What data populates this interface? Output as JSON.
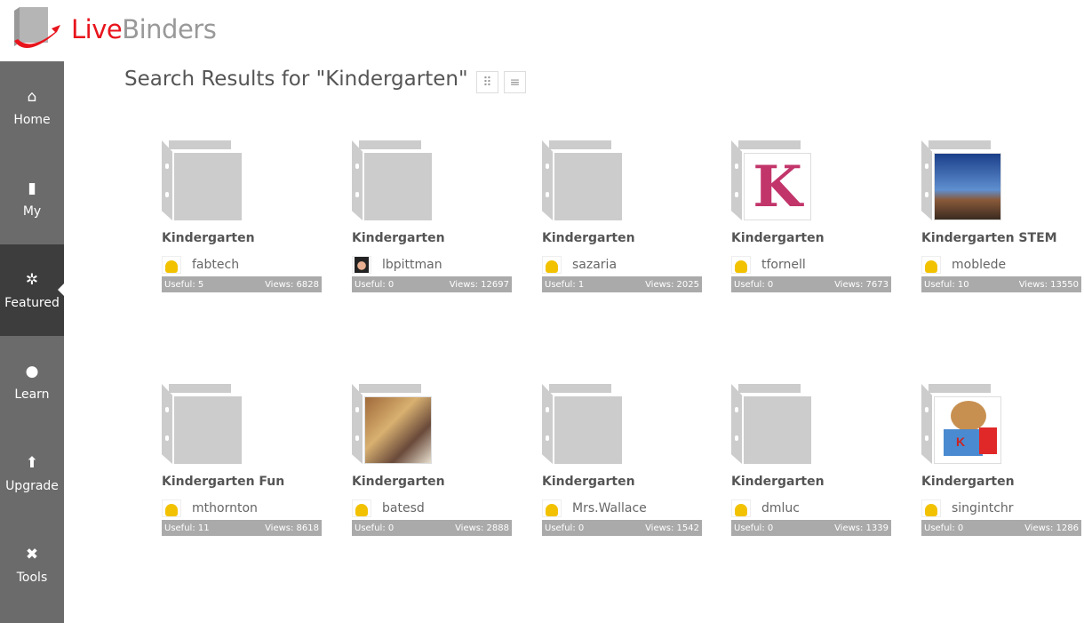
{
  "logo": {
    "live": "Live",
    "binders": "Binders"
  },
  "sidebar": [
    {
      "label": "Home",
      "icon": "home-icon"
    },
    {
      "label": "My",
      "icon": "binder-icon"
    },
    {
      "label": "Featured",
      "icon": "gear-icon",
      "active": true
    },
    {
      "label": "Learn",
      "icon": "lightbulb-icon"
    },
    {
      "label": "Upgrade",
      "icon": "arrow-up-icon"
    },
    {
      "label": "Tools",
      "icon": "tools-icon"
    }
  ],
  "page_title": "Search Results for \"Kindergarten\"",
  "binders": [
    {
      "title": "Kindergarten",
      "user": "fabtech",
      "useful": "Useful: 5",
      "views": "Views: 6828",
      "thumb": "none",
      "avatar": "default"
    },
    {
      "title": "Kindergarten",
      "user": "lbpittman",
      "useful": "Useful: 0",
      "views": "Views: 12697",
      "thumb": "none",
      "avatar": "photo"
    },
    {
      "title": "Kindergarten",
      "user": "sazaria",
      "useful": "Useful: 1",
      "views": "Views: 2025",
      "thumb": "none",
      "avatar": "default"
    },
    {
      "title": "Kindergarten",
      "user": "tfornell",
      "useful": "Useful: 0",
      "views": "Views: 7673",
      "thumb": "letter-k",
      "avatar": "default"
    },
    {
      "title": "Kindergarten STEM",
      "user": "moblede",
      "useful": "Useful: 10",
      "views": "Views: 13550",
      "thumb": "sky",
      "avatar": "default"
    },
    {
      "title": "Kindergarten Fun",
      "user": "mthornton",
      "useful": "Useful: 11",
      "views": "Views: 8618",
      "thumb": "none",
      "avatar": "default"
    },
    {
      "title": "Kindergarten",
      "user": "batesd",
      "useful": "Useful: 0",
      "views": "Views: 2888",
      "thumb": "classroom",
      "avatar": "default"
    },
    {
      "title": "Kindergarten",
      "user": "Mrs.Wallace",
      "useful": "Useful: 0",
      "views": "Views: 1542",
      "thumb": "none",
      "avatar": "default"
    },
    {
      "title": "Kindergarten",
      "user": "dmluc",
      "useful": "Useful: 0",
      "views": "Views: 1339",
      "thumb": "none",
      "avatar": "default"
    },
    {
      "title": "Kindergarten",
      "user": "singintchr",
      "useful": "Useful: 0",
      "views": "Views: 1286",
      "thumb": "bear",
      "avatar": "default"
    }
  ]
}
